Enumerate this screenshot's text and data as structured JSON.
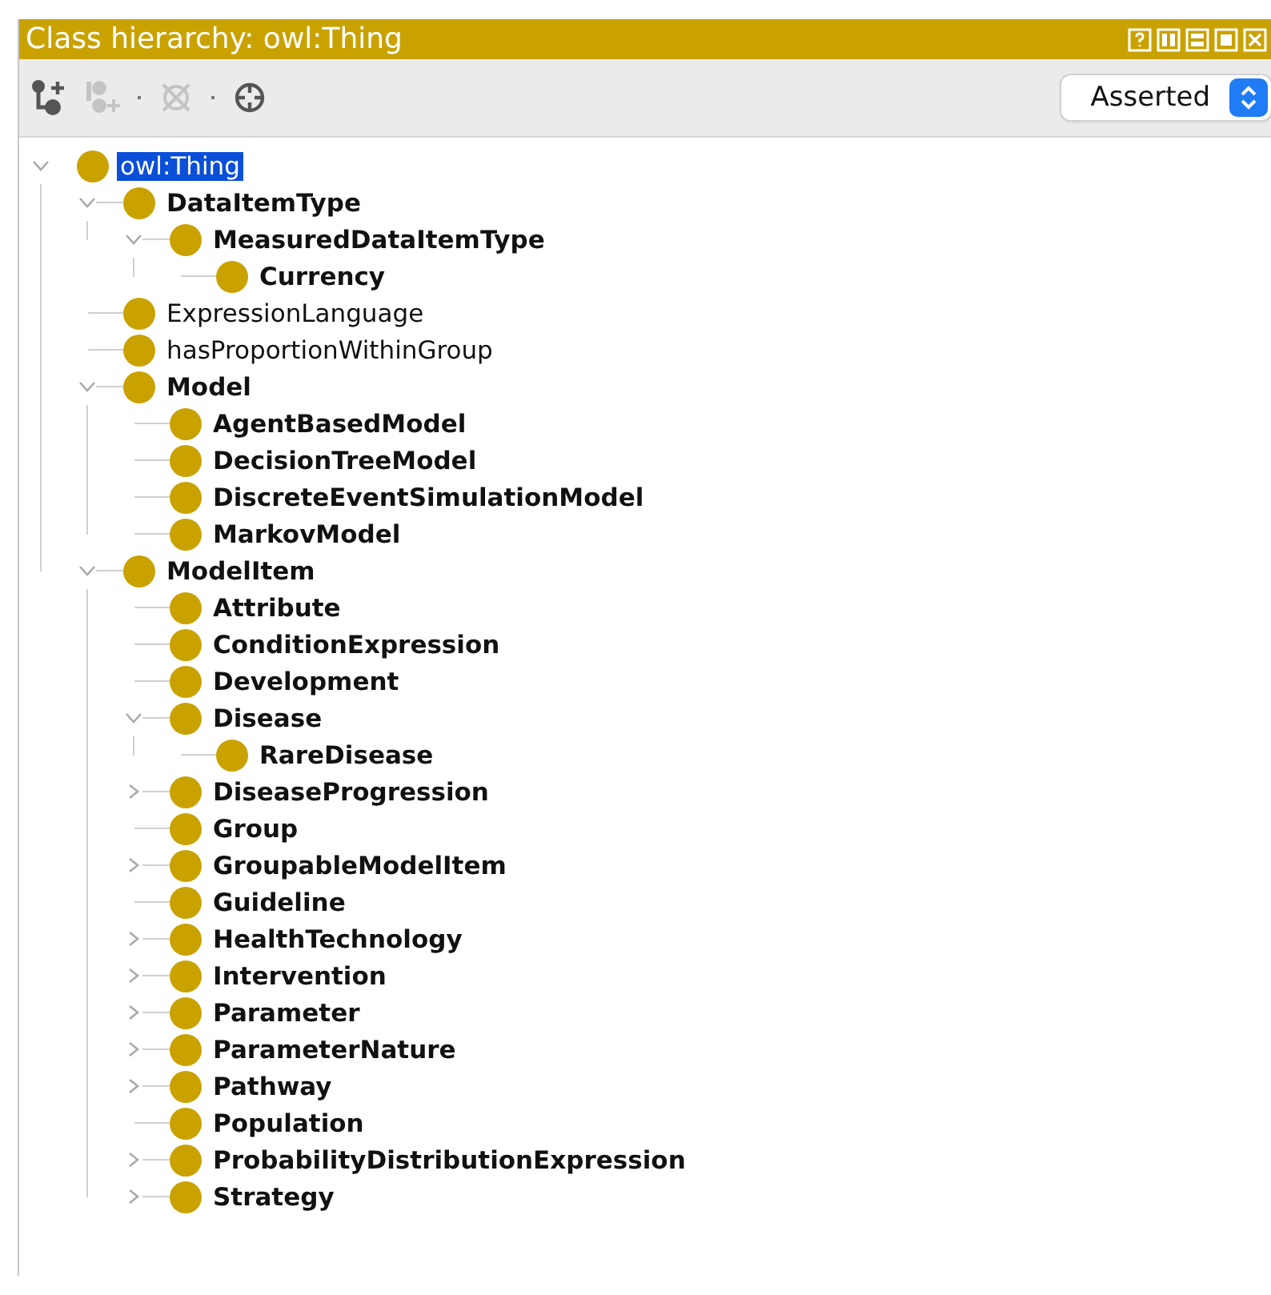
{
  "panel": {
    "title": "Class hierarchy: owl:Thing",
    "window_buttons": [
      {
        "kind": "help"
      },
      {
        "kind": "split-columns"
      },
      {
        "kind": "split-rows"
      },
      {
        "kind": "maximize"
      },
      {
        "kind": "close"
      }
    ],
    "toolbar": [
      {
        "kind": "add-subclass",
        "disabled": false
      },
      {
        "kind": "add-sibling",
        "disabled": true
      },
      {
        "kind": "delete",
        "disabled": true
      },
      {
        "kind": "find",
        "disabled": false
      }
    ],
    "view_select": {
      "value": "Asserted"
    }
  },
  "tree": [
    {
      "label": "owl:Thing",
      "bold": false,
      "selected": true,
      "expanded": true,
      "children": [
        {
          "label": "DataItemType",
          "bold": true,
          "selected": false,
          "expanded": true,
          "children": [
            {
              "label": "MeasuredDataItemType",
              "bold": true,
              "selected": false,
              "expanded": true,
              "children": [
                {
                  "label": "Currency",
                  "bold": true,
                  "selected": false
                }
              ]
            }
          ]
        },
        {
          "label": "ExpressionLanguage",
          "bold": false,
          "selected": false
        },
        {
          "label": "hasProportionWithinGroup",
          "bold": false,
          "selected": false
        },
        {
          "label": "Model",
          "bold": true,
          "selected": false,
          "expanded": true,
          "children": [
            {
              "label": "AgentBasedModel",
              "bold": true,
              "selected": false
            },
            {
              "label": "DecisionTreeModel",
              "bold": true,
              "selected": false
            },
            {
              "label": "DiscreteEventSimulationModel",
              "bold": true,
              "selected": false
            },
            {
              "label": "MarkovModel",
              "bold": true,
              "selected": false
            }
          ]
        },
        {
          "label": "ModelItem",
          "bold": true,
          "selected": false,
          "expanded": true,
          "children": [
            {
              "label": "Attribute",
              "bold": true,
              "selected": false
            },
            {
              "label": "ConditionExpression",
              "bold": true,
              "selected": false
            },
            {
              "label": "Development",
              "bold": true,
              "selected": false
            },
            {
              "label": "Disease",
              "bold": true,
              "selected": false,
              "expanded": true,
              "children": [
                {
                  "label": "RareDisease",
                  "bold": true,
                  "selected": false
                }
              ]
            },
            {
              "label": "DiseaseProgression",
              "bold": true,
              "selected": false,
              "expanded": false
            },
            {
              "label": "Group",
              "bold": true,
              "selected": false
            },
            {
              "label": "GroupableModelItem",
              "bold": true,
              "selected": false,
              "expanded": false
            },
            {
              "label": "Guideline",
              "bold": true,
              "selected": false
            },
            {
              "label": "HealthTechnology",
              "bold": true,
              "selected": false,
              "expanded": false
            },
            {
              "label": "Intervention",
              "bold": true,
              "selected": false,
              "expanded": false
            },
            {
              "label": "Parameter",
              "bold": true,
              "selected": false,
              "expanded": false
            },
            {
              "label": "ParameterNature",
              "bold": true,
              "selected": false,
              "expanded": false
            },
            {
              "label": "Pathway",
              "bold": true,
              "selected": false,
              "expanded": false
            },
            {
              "label": "Population",
              "bold": true,
              "selected": false
            },
            {
              "label": "ProbabilityDistributionExpression",
              "bold": true,
              "selected": false,
              "expanded": false
            },
            {
              "label": "Strategy",
              "bold": true,
              "selected": false,
              "expanded": false
            }
          ]
        }
      ]
    }
  ]
}
